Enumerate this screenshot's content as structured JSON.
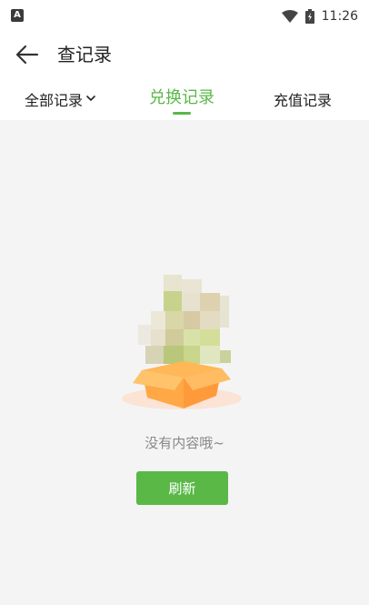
{
  "status_bar": {
    "time": "11:26",
    "left_icon": "A",
    "icons": [
      "wifi-icon",
      "battery-icon"
    ]
  },
  "header": {
    "title": "查记录",
    "back_icon": "arrow-left-icon"
  },
  "tabs": [
    {
      "label": "全部记录",
      "active": false,
      "has_dropdown": true
    },
    {
      "label": "兑换记录",
      "active": true
    },
    {
      "label": "充值记录",
      "active": false
    }
  ],
  "empty_state": {
    "message": "没有内容哦~",
    "button_label": "刷新"
  },
  "colors": {
    "accent": "#5ab847",
    "background": "#f4f4f4",
    "muted_text": "#888888"
  }
}
